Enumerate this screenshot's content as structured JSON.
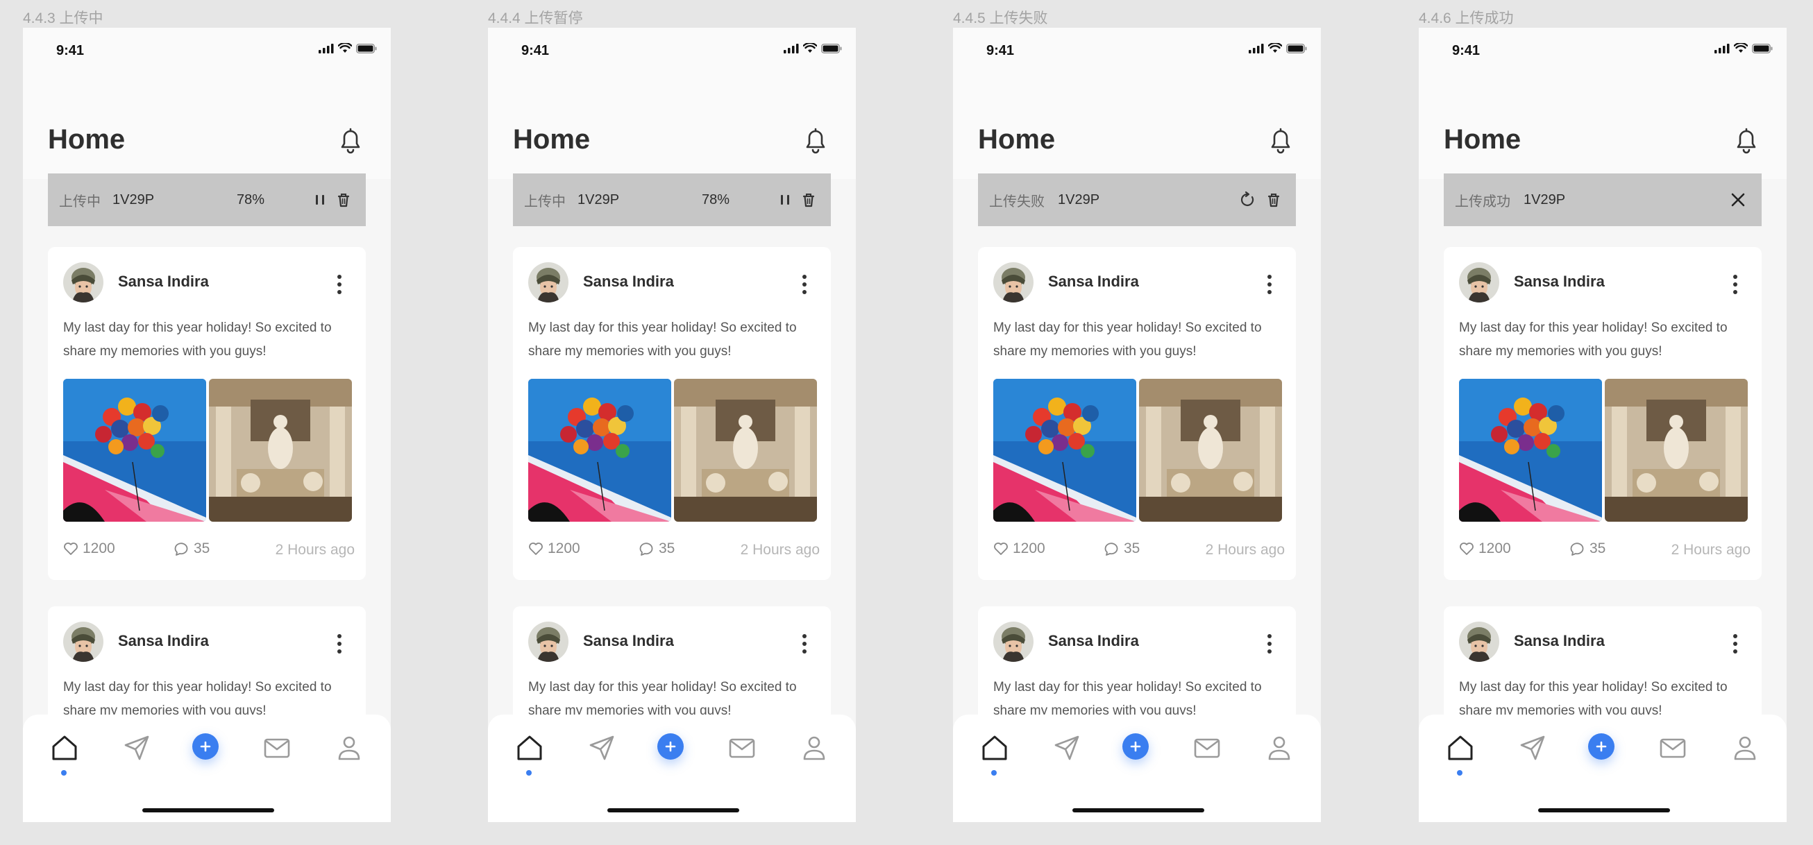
{
  "frames": [
    {
      "label": "4.4.3 上传中",
      "upload_status": "上传中",
      "file": "1V29P",
      "percent": "78%",
      "state": "uploading"
    },
    {
      "label": "4.4.4 上传暂停",
      "upload_status": "上传中",
      "file": "1V29P",
      "percent": "78%",
      "state": "paused"
    },
    {
      "label": "4.4.5 上传失败",
      "upload_status": "上传失败",
      "file": "1V29P",
      "percent": "",
      "state": "failed"
    },
    {
      "label": "4.4.6 上传成功",
      "upload_status": "上传成功",
      "file": "1V29P",
      "percent": "",
      "state": "success"
    }
  ],
  "status_bar": {
    "time": "9:41"
  },
  "header": {
    "title": "Home"
  },
  "post": {
    "author": "Sansa Indira",
    "text": "My last day for this year holiday! So excited to share my memories with you guys!",
    "likes": "1200",
    "comments": "35",
    "time_ago": "2 Hours ago"
  },
  "tabs": [
    "home-icon",
    "send-icon",
    "add-icon",
    "mail-icon",
    "profile-icon"
  ],
  "colors": {
    "accent": "#3a7ef0",
    "upload_bar": "#c6c6c6",
    "background": "#e6e6e6"
  }
}
